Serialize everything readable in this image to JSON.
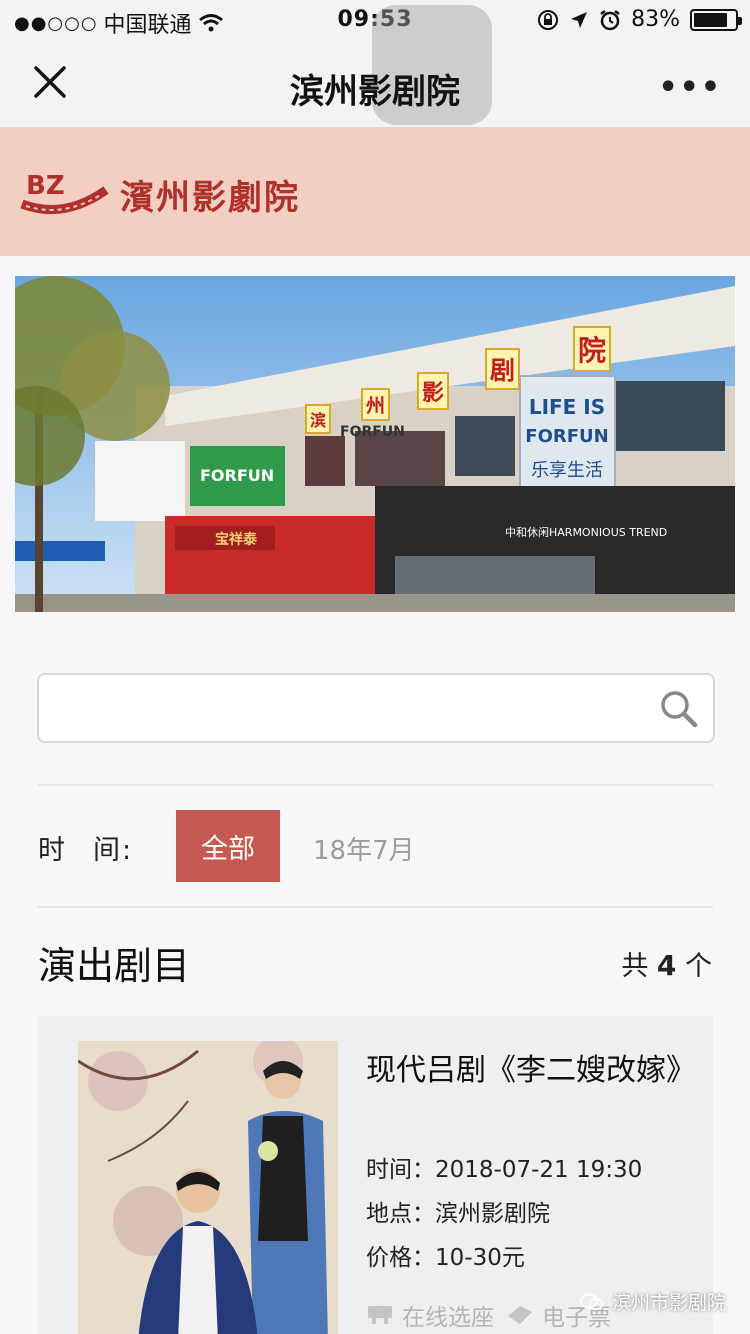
{
  "status_bar": {
    "signal": "●●○○○",
    "carrier": "中国联通",
    "time": "09:53",
    "battery_percent": "83%",
    "battery_level": 0.83
  },
  "nav": {
    "title": "滨州影剧院",
    "more": "•••"
  },
  "brand": {
    "logo_text": "BZ",
    "name": "濱州影劇院",
    "color": "#b0302b",
    "background": "#f2cfc1"
  },
  "hero": {
    "sign_chars": [
      "滨",
      "州",
      "影",
      "剧",
      "院"
    ],
    "billboard_line1": "LIFE IS",
    "billboard_line2": "FORFUN",
    "billboard_line3": "乐享生活",
    "store_name": "FORFUN",
    "lower_store": "中和休闲HARMONIOUS TREND",
    "shop_sign": "宝祥泰",
    "green_sign": "FORFUN"
  },
  "search": {
    "placeholder": ""
  },
  "filter": {
    "label_a": "时",
    "label_b": "间:",
    "all_label": "全部",
    "month_label": "18年7月",
    "accent_color": "#c65a52"
  },
  "section": {
    "title": "演出剧目",
    "count_prefix": "共",
    "count": "4",
    "count_suffix": "个"
  },
  "shows": [
    {
      "title": "现代吕剧《李二嫂改嫁》",
      "time_label": "时间：",
      "time_value": "2018-07-21 19:30",
      "venue_label": "地点：",
      "venue_value": "滨州影剧院",
      "price_label": "价格：",
      "price_value": "10-30元",
      "action_seat": "在线选座",
      "action_ticket": "电子票"
    }
  ],
  "watermark": {
    "text": "滨州市影剧院"
  }
}
